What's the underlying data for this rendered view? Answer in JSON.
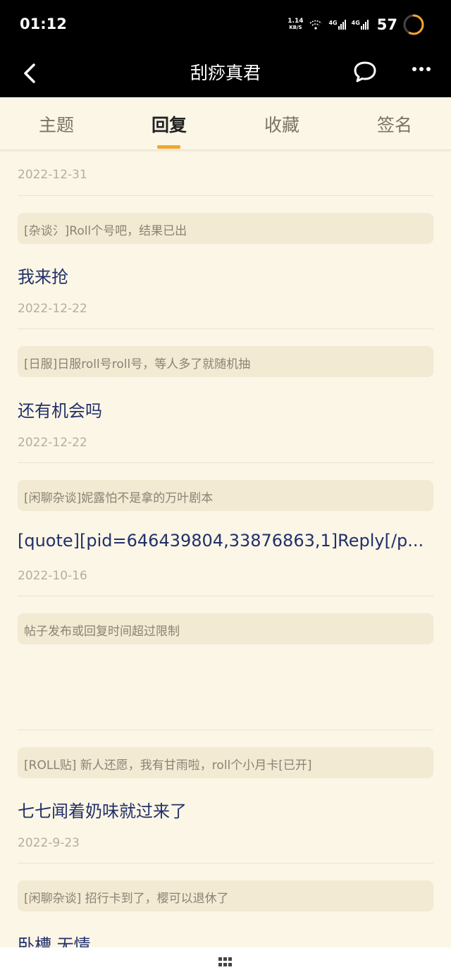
{
  "status": {
    "time": "01:12",
    "net_speed_value": "1.14",
    "net_speed_unit": "KB/S",
    "sim1": "4G",
    "sim2": "4G",
    "battery": "57"
  },
  "header": {
    "title": "刮痧真君"
  },
  "tabs": [
    {
      "label": "主题"
    },
    {
      "label": "回复"
    },
    {
      "label": "收藏"
    },
    {
      "label": "签名"
    }
  ],
  "active_tab": "回复",
  "list": {
    "first_date": "2022-12-31",
    "items": [
      {
        "topic": "[杂谈氵]Roll个号吧，结果已出",
        "reply": "我来抢",
        "date": "2022-12-22"
      },
      {
        "topic": "[日服]日服roll号roll号，等人多了就随机抽",
        "reply": "还有机会吗",
        "date": "2022-12-22"
      },
      {
        "topic": "[闲聊杂谈]妮露怕不是拿的万叶剧本",
        "reply": "[quote][pid=646439804,33876863,1]Reply[/p...",
        "date": "2022-10-16"
      },
      {
        "topic": "帖子发布或回复时间超过限制",
        "reply": "",
        "date": ""
      },
      {
        "topic": "[ROLL贴] 新人还愿，我有甘雨啦，roll个小月卡[已开]",
        "reply": "七七闻着奶味就过来了",
        "date": "2022-9-23"
      },
      {
        "topic": "[闲聊杂谈] 招行卡到了，樱可以退休了",
        "reply": "卧槽 无情",
        "date": ""
      }
    ]
  },
  "colors": {
    "accent": "#f2a531",
    "background": "#fbf6e6",
    "reply_text": "#22306a"
  }
}
